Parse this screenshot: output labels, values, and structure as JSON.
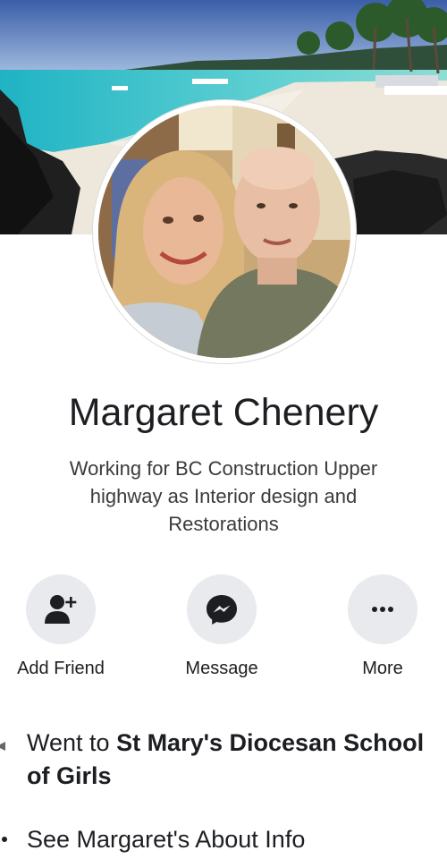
{
  "profile": {
    "name": "Margaret Chenery",
    "bio": "Working for BC Construction Upper highway as Interior design and Restorations"
  },
  "actions": [
    {
      "label": "Add Friend",
      "icon": "add-friend-icon"
    },
    {
      "label": "Message",
      "icon": "messenger-icon"
    },
    {
      "label": "More",
      "icon": "more-icon"
    }
  ],
  "info": {
    "education_prefix": "Went to ",
    "education_school": "St Mary's Diocesan School of Girls",
    "about_link": "See Margaret's About Info"
  },
  "colors": {
    "button_bg": "#e8eaed",
    "text": "#1c1e21",
    "secondary_text": "#3a3b3c"
  }
}
